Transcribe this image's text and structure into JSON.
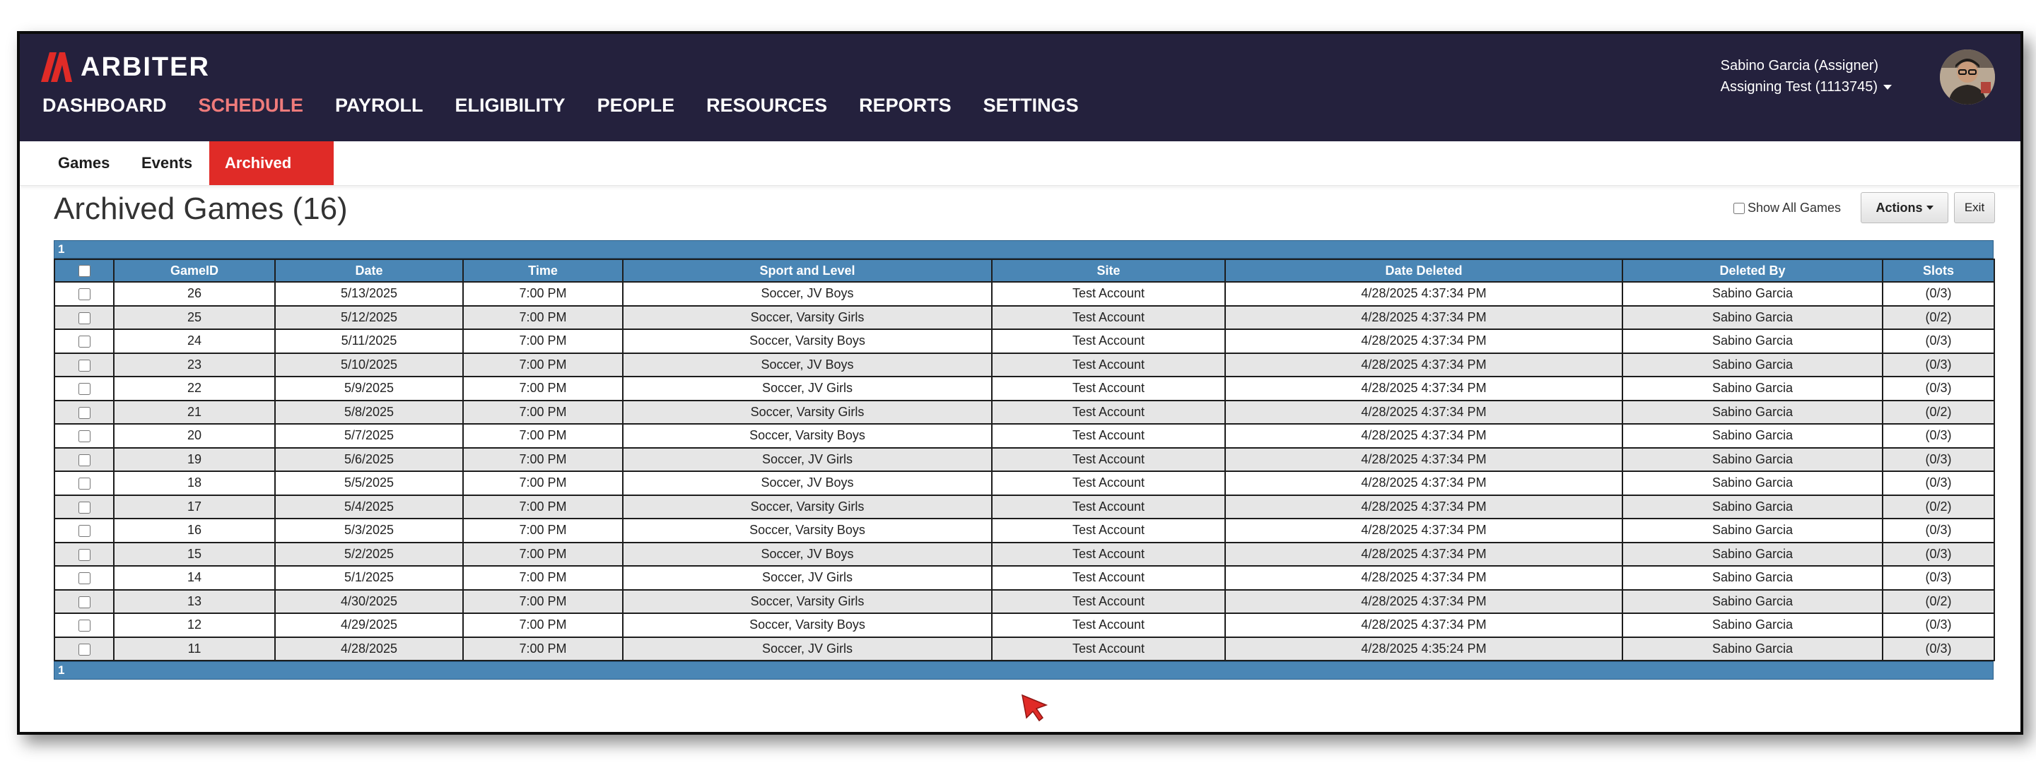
{
  "brand": {
    "name": "ARBITER",
    "logo_color": "#e02b27"
  },
  "main_nav": [
    {
      "label": "DASHBOARD",
      "active": false
    },
    {
      "label": "SCHEDULE",
      "active": true
    },
    {
      "label": "PAYROLL",
      "active": false
    },
    {
      "label": "ELIGIBILITY",
      "active": false
    },
    {
      "label": "PEOPLE",
      "active": false
    },
    {
      "label": "RESOURCES",
      "active": false
    },
    {
      "label": "REPORTS",
      "active": false
    },
    {
      "label": "SETTINGS",
      "active": false
    }
  ],
  "user": {
    "name_role": "Sabino Garcia (Assigner)",
    "account": "Assigning Test (1113745)"
  },
  "sub_nav": [
    {
      "label": "Games",
      "active": false
    },
    {
      "label": "Events",
      "active": false
    },
    {
      "label": "Archived Games",
      "active": true
    }
  ],
  "page_title": "Archived Games (16)",
  "controls": {
    "show_all_label": "Show All Games",
    "actions_label": "Actions",
    "exit_label": "Exit"
  },
  "pager": {
    "page": "1"
  },
  "table": {
    "columns": [
      "GameID",
      "Date",
      "Time",
      "Sport and Level",
      "Site",
      "Date Deleted",
      "Deleted By",
      "Slots"
    ],
    "rows": [
      [
        "26",
        "5/13/2025",
        "7:00 PM",
        "Soccer, JV Boys",
        "Test Account",
        "4/28/2025 4:37:34 PM",
        "Sabino Garcia",
        "(0/3)"
      ],
      [
        "25",
        "5/12/2025",
        "7:00 PM",
        "Soccer, Varsity Girls",
        "Test Account",
        "4/28/2025 4:37:34 PM",
        "Sabino Garcia",
        "(0/2)"
      ],
      [
        "24",
        "5/11/2025",
        "7:00 PM",
        "Soccer, Varsity Boys",
        "Test Account",
        "4/28/2025 4:37:34 PM",
        "Sabino Garcia",
        "(0/3)"
      ],
      [
        "23",
        "5/10/2025",
        "7:00 PM",
        "Soccer, JV Boys",
        "Test Account",
        "4/28/2025 4:37:34 PM",
        "Sabino Garcia",
        "(0/3)"
      ],
      [
        "22",
        "5/9/2025",
        "7:00 PM",
        "Soccer, JV Girls",
        "Test Account",
        "4/28/2025 4:37:34 PM",
        "Sabino Garcia",
        "(0/3)"
      ],
      [
        "21",
        "5/8/2025",
        "7:00 PM",
        "Soccer, Varsity Girls",
        "Test Account",
        "4/28/2025 4:37:34 PM",
        "Sabino Garcia",
        "(0/2)"
      ],
      [
        "20",
        "5/7/2025",
        "7:00 PM",
        "Soccer, Varsity Boys",
        "Test Account",
        "4/28/2025 4:37:34 PM",
        "Sabino Garcia",
        "(0/3)"
      ],
      [
        "19",
        "5/6/2025",
        "7:00 PM",
        "Soccer, JV Girls",
        "Test Account",
        "4/28/2025 4:37:34 PM",
        "Sabino Garcia",
        "(0/3)"
      ],
      [
        "18",
        "5/5/2025",
        "7:00 PM",
        "Soccer, JV Boys",
        "Test Account",
        "4/28/2025 4:37:34 PM",
        "Sabino Garcia",
        "(0/3)"
      ],
      [
        "17",
        "5/4/2025",
        "7:00 PM",
        "Soccer, Varsity Girls",
        "Test Account",
        "4/28/2025 4:37:34 PM",
        "Sabino Garcia",
        "(0/2)"
      ],
      [
        "16",
        "5/3/2025",
        "7:00 PM",
        "Soccer, Varsity Boys",
        "Test Account",
        "4/28/2025 4:37:34 PM",
        "Sabino Garcia",
        "(0/3)"
      ],
      [
        "15",
        "5/2/2025",
        "7:00 PM",
        "Soccer, JV Boys",
        "Test Account",
        "4/28/2025 4:37:34 PM",
        "Sabino Garcia",
        "(0/3)"
      ],
      [
        "14",
        "5/1/2025",
        "7:00 PM",
        "Soccer, JV Girls",
        "Test Account",
        "4/28/2025 4:37:34 PM",
        "Sabino Garcia",
        "(0/3)"
      ],
      [
        "13",
        "4/30/2025",
        "7:00 PM",
        "Soccer, Varsity Girls",
        "Test Account",
        "4/28/2025 4:37:34 PM",
        "Sabino Garcia",
        "(0/2)"
      ],
      [
        "12",
        "4/29/2025",
        "7:00 PM",
        "Soccer, Varsity Boys",
        "Test Account",
        "4/28/2025 4:37:34 PM",
        "Sabino Garcia",
        "(0/3)"
      ],
      [
        "11",
        "4/28/2025",
        "7:00 PM",
        "Soccer, JV Girls",
        "Test Account",
        "4/28/2025 4:35:24 PM",
        "Sabino Garcia",
        "(0/3)"
      ]
    ]
  },
  "colors": {
    "header_bg": "#24213d",
    "nav_active": "#ef7b7b",
    "tab_active_bg": "#e02b27",
    "grid_header_bg": "#4a86b5",
    "row_alt_bg": "#e6e6e6"
  },
  "icons": {
    "logo": "arbiter-logo-icon",
    "caret": "caret-down-icon",
    "cursor": "mouse-pointer-icon",
    "avatar": "user-avatar"
  }
}
